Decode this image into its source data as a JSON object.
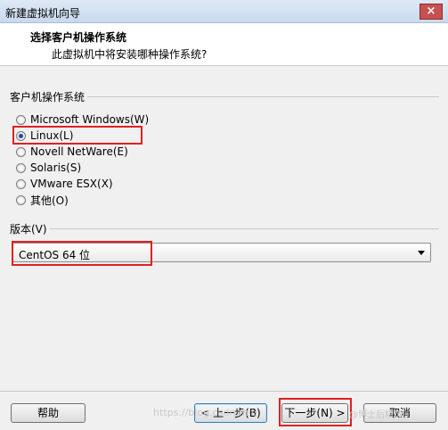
{
  "window": {
    "title": "新建虚拟机向导",
    "close_label": "×"
  },
  "header": {
    "title": "选择客户机操作系统",
    "subtitle": "此虚拟机中将安装哪种操作系统?"
  },
  "os_group": {
    "label": "客户机操作系统",
    "options": [
      {
        "label": "Microsoft Windows(W)",
        "checked": false
      },
      {
        "label": "Linux(L)",
        "checked": true
      },
      {
        "label": "Novell NetWare(E)",
        "checked": false
      },
      {
        "label": "Solaris(S)",
        "checked": false
      },
      {
        "label": "VMware ESX(X)",
        "checked": false
      },
      {
        "label": "其他(O)",
        "checked": false
      }
    ]
  },
  "version_group": {
    "label": "版本(V)",
    "selected": "CentOS 64 位"
  },
  "buttons": {
    "help": "帮助",
    "back": "< 上一步(B)",
    "next": "下一步(N) >",
    "cancel": "取消"
  },
  "watermark": {
    "text": "https://blog.csdn.net/",
    "text2": "@博士后精选"
  },
  "colors": {
    "highlight": "#e02020",
    "title_bar": "#c9d9ee"
  }
}
